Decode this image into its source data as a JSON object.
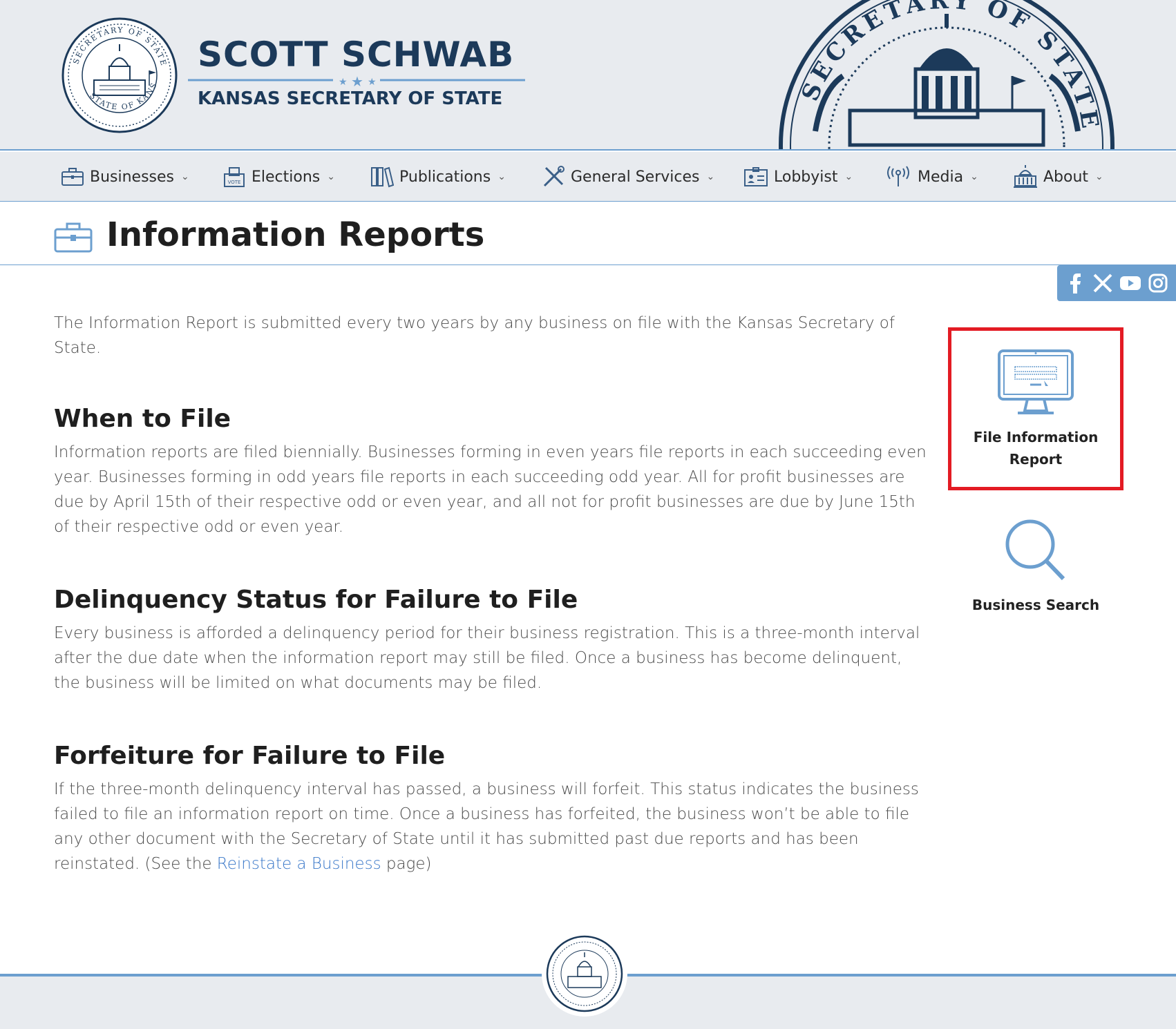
{
  "header": {
    "brand_name": "SCOTT SCHWAB",
    "brand_subtitle": "KANSAS SECRETARY OF STATE",
    "seal_text_top": "SECRETARY OF STATE",
    "seal_text_bottom": "STATE OF KANSAS",
    "seal_large_text": "SECRETARY OF STATE"
  },
  "nav": {
    "items": [
      {
        "label": "Businesses",
        "icon": "briefcase-icon"
      },
      {
        "label": "Elections",
        "icon": "ballot-box-icon",
        "icon_text": "VOTE"
      },
      {
        "label": "Publications",
        "icon": "books-icon"
      },
      {
        "label": "General Services",
        "icon": "tools-icon"
      },
      {
        "label": "Lobbyist",
        "icon": "id-badge-icon"
      },
      {
        "label": "Media",
        "icon": "broadcast-icon"
      },
      {
        "label": "About",
        "icon": "capitol-icon"
      }
    ],
    "chevron": "⌄"
  },
  "page": {
    "title": "Information Reports"
  },
  "social": [
    "facebook-icon",
    "x-icon",
    "youtube-icon",
    "instagram-icon"
  ],
  "content": {
    "intro": "The Information Report is submitted every two years by any business on file with the Kansas Secretary of State.",
    "sections": [
      {
        "heading": "When to File",
        "body": "Information reports are filed biennially. Businesses forming in even years file reports in each succeeding even year. Businesses forming in odd years file reports in each succeeding odd year. All for profit businesses are due by April 15th of their respective odd or even year, and all not for profit businesses are due by June 15th of their respective odd or even year."
      },
      {
        "heading": "Delinquency Status for Failure to File",
        "body": "Every business is afforded a delinquency period for their business registration. This is a three-month interval after the due date when the information report may still be filed. Once a business has become delinquent, the business will be limited on what documents may be filed."
      },
      {
        "heading": "Forfeiture for Failure to File",
        "body_before_link": "If the three-month delinquency interval has passed, a business will forfeit. This status indicates the business failed to file an information report on time. Once a business has forfeited, the business won’t be able to file any other document with the Secretary of State until it has submitted past due reports and has been reinstated. (See the ",
        "link_text": "Reinstate a Business",
        "body_after_link": " page)"
      }
    ]
  },
  "sidebar": {
    "file_report_label": "File Information Report",
    "business_search_label": "Business Search"
  },
  "colors": {
    "accent": "#6c9fcf",
    "navy": "#1c3a5a",
    "highlight": "#e31b23",
    "link": "#3a78c9"
  }
}
